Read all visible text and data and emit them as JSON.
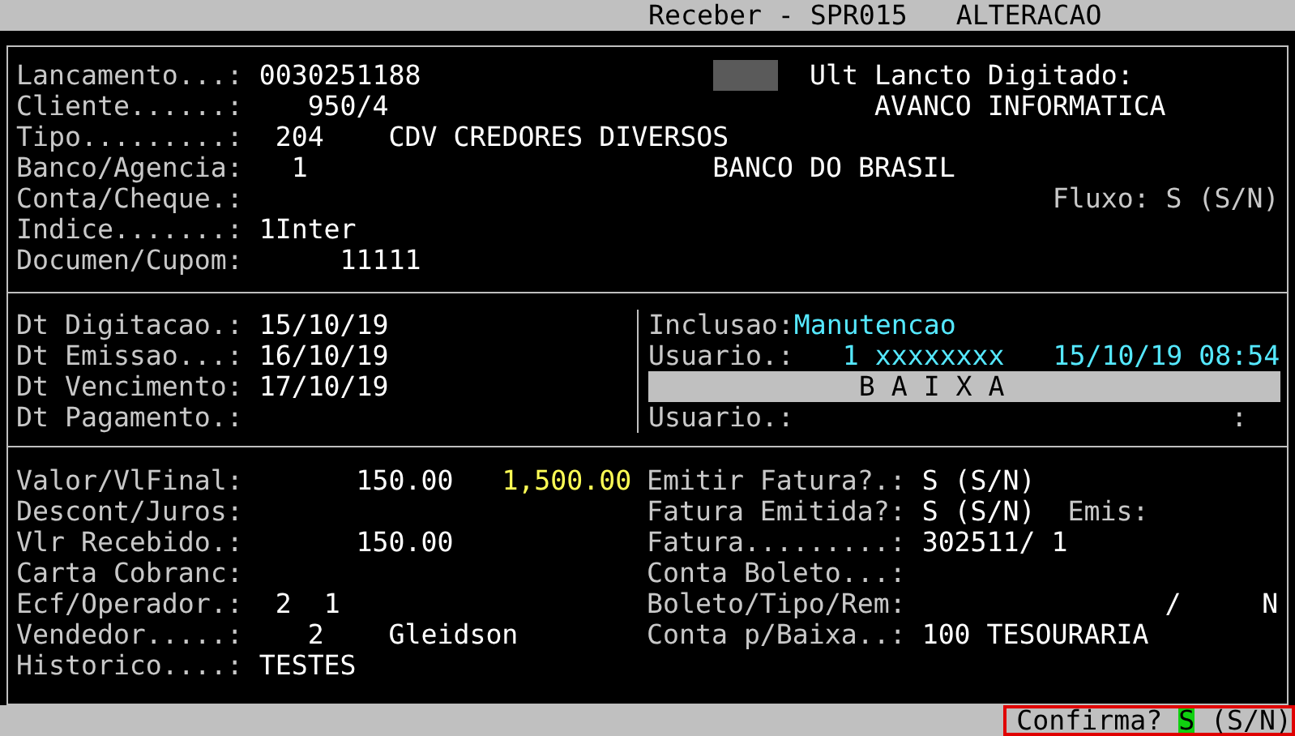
{
  "window": {
    "title": "Receber - SPR015",
    "mode": "ALTERACAO"
  },
  "panels": [
    {
      "columns": [
        {
          "lines": [
            [
              {
                "kind": "label",
                "text": "Lancamento...:"
              },
              {
                "kind": "value",
                "text": "0030251188"
              },
              {
                "kind": "mask"
              },
              {
                "kind": "value",
                "text": "Ult Lancto Digitado:"
              }
            ],
            [
              {
                "kind": "label",
                "text": "Cliente......:"
              },
              {
                "kind": "value",
                "text": "950/4"
              },
              {
                "kind": "value",
                "text": "AVANCO INFORMATICA"
              }
            ],
            [
              {
                "kind": "label",
                "text": "Tipo.........:"
              },
              {
                "kind": "value",
                "text": "204"
              },
              {
                "kind": "value",
                "text": "CDV CREDORES DIVERSOS"
              }
            ],
            [
              {
                "kind": "label",
                "text": "Banco/Agencia:"
              },
              {
                "kind": "value",
                "text": "1"
              },
              {
                "kind": "value",
                "text": "BANCO DO BRASIL"
              }
            ],
            [
              {
                "kind": "label",
                "text": "Conta/Cheque.:"
              },
              {
                "kind": "label",
                "text": "Fluxo: S (S/N)"
              }
            ],
            [
              {
                "kind": "label",
                "text": "Indice.......:"
              },
              {
                "kind": "value",
                "text": "1Inter"
              }
            ],
            [
              {
                "kind": "label",
                "text": "Documen/Cupom:"
              },
              {
                "kind": "value",
                "text": "11111"
              }
            ]
          ]
        }
      ]
    },
    {
      "columns": [
        {
          "lines": [
            [
              {
                "kind": "label",
                "text": "Dt Digitacao.:"
              },
              {
                "kind": "value",
                "text": "15/10/19"
              }
            ],
            [
              {
                "kind": "label",
                "text": "Dt Emissao...:"
              },
              {
                "kind": "value",
                "text": "16/10/19"
              }
            ],
            [
              {
                "kind": "label",
                "text": "Dt Vencimento:"
              },
              {
                "kind": "value",
                "text": "17/10/19"
              }
            ],
            [
              {
                "kind": "label",
                "text": "Dt Pagamento.:"
              }
            ]
          ]
        },
        {
          "lines": [
            [
              {
                "kind": "label",
                "text": "Inclusao:"
              },
              {
                "kind": "info",
                "text": "Manutencao"
              }
            ],
            [
              {
                "kind": "label",
                "text": "Usuario.:"
              },
              {
                "kind": "info",
                "text": "1 xxxxxxxx"
              },
              {
                "kind": "info",
                "text": "15/10/19 08:54"
              }
            ],
            [
              {
                "kind": "bar",
                "text": "B A I X A"
              }
            ],
            [
              {
                "kind": "label",
                "text": "Usuario.:"
              },
              {
                "kind": "label",
                "text": ":"
              }
            ]
          ]
        }
      ]
    },
    {
      "columns": [
        {
          "lines": [
            [
              {
                "kind": "label",
                "text": "Valor/VlFinal:"
              },
              {
                "kind": "value",
                "text": "150.00"
              },
              {
                "kind": "total",
                "text": "1,500.00"
              }
            ],
            [
              {
                "kind": "label",
                "text": "Descont/Juros:"
              }
            ],
            [
              {
                "kind": "label",
                "text": "Vlr Recebido.:"
              },
              {
                "kind": "value",
                "text": "150.00"
              }
            ],
            [
              {
                "kind": "label",
                "text": "Carta Cobranc:"
              }
            ],
            [
              {
                "kind": "label",
                "text": "Ecf/Operador.:"
              },
              {
                "kind": "value",
                "text": "2"
              },
              {
                "kind": "value",
                "text": "1"
              }
            ],
            [
              {
                "kind": "label",
                "text": "Vendedor.....:"
              },
              {
                "kind": "value",
                "text": "2"
              },
              {
                "kind": "value",
                "text": "Gleidson"
              }
            ],
            [
              {
                "kind": "label",
                "text": "Historico....:"
              },
              {
                "kind": "value",
                "text": "TESTES"
              }
            ]
          ]
        },
        {
          "lines": [
            [
              {
                "kind": "label",
                "text": "Emitir Fatura?.:"
              },
              {
                "kind": "value",
                "text": "S (S/N)"
              }
            ],
            [
              {
                "kind": "label",
                "text": "Fatura Emitida?:"
              },
              {
                "kind": "value",
                "text": "S (S/N)"
              },
              {
                "kind": "label",
                "text": "Emis:"
              }
            ],
            [
              {
                "kind": "label",
                "text": "Fatura.........:"
              },
              {
                "kind": "value",
                "text": "302511/ 1"
              }
            ],
            [
              {
                "kind": "label",
                "text": "Conta Boleto...:"
              }
            ],
            [
              {
                "kind": "label",
                "text": "Boleto/Tipo/Rem:"
              },
              {
                "kind": "value",
                "text": "/"
              },
              {
                "kind": "value",
                "text": "N"
              }
            ],
            [
              {
                "kind": "label",
                "text": "Conta p/Baixa..:"
              },
              {
                "kind": "value",
                "text": "100 TESOURARIA"
              }
            ]
          ]
        }
      ]
    }
  ],
  "status_bar": {
    "prompt": "Confirma?",
    "answer": "S",
    "options": "(S/N)"
  }
}
